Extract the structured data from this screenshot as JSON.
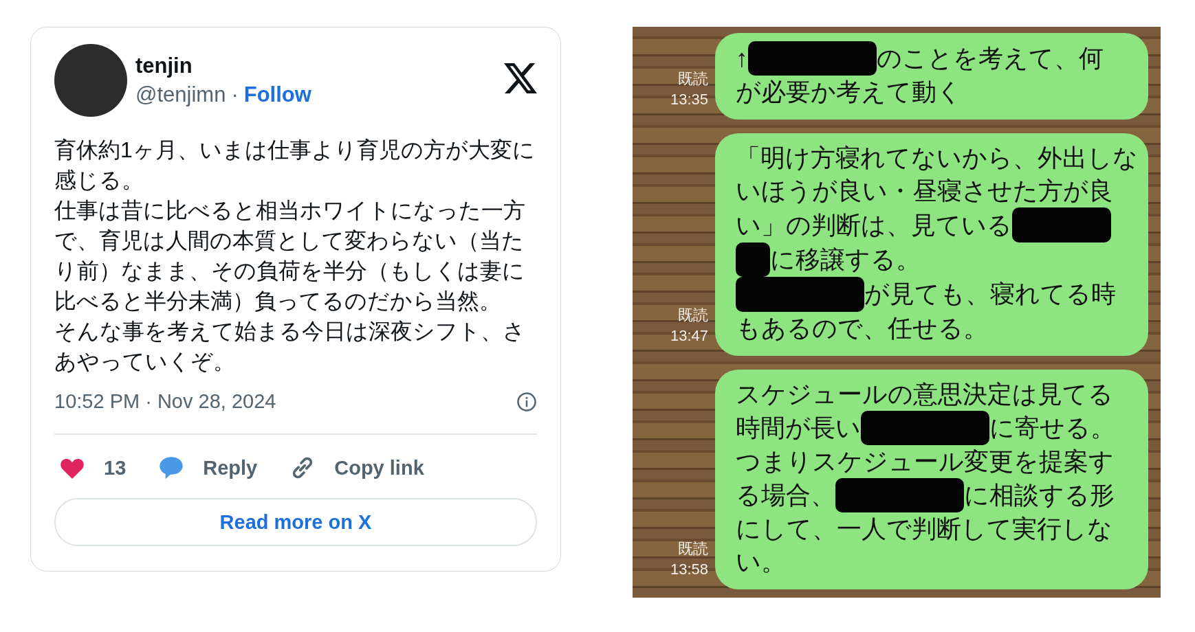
{
  "tweet": {
    "author": {
      "name": "tenjin",
      "handle": "@tenjimn",
      "separator": "·",
      "follow": "Follow"
    },
    "body": [
      "育休約1ヶ月、いまは仕事より育児の方が大変に感じる。",
      "仕事は昔に比べると相当ホワイトになった一方で、育児は人間の本質として変わらない（当たり前）なまま、その負荷を半分（もしくは妻に比べると半分未満）負ってるのだから当然。",
      "そんな事を考えて始まる今日は深夜シフト、さあやっていくぞ。"
    ],
    "timestamp": "10:52 PM · Nov 28, 2024",
    "actions": [
      {
        "kind": "like",
        "label": "13"
      },
      {
        "kind": "reply",
        "label": "Reply"
      },
      {
        "kind": "copy_link",
        "label": "Copy link"
      }
    ],
    "read_more": "Read more on X"
  },
  "chat": {
    "messages": [
      {
        "read": "既読",
        "time": "13:35",
        "lines": [
          [
            {
              "kind": "text",
              "text": "↑"
            },
            {
              "kind": "redacted_long"
            },
            {
              "kind": "text",
              "text": "のことを考えて、何"
            }
          ],
          [
            {
              "kind": "text",
              "text": "が必要か考えて動く"
            }
          ]
        ]
      },
      {
        "read": "既読",
        "time": "13:47",
        "lines": [
          [
            {
              "kind": "text",
              "text": "「明け方寝れてないから、外出しな"
            }
          ],
          [
            {
              "kind": "text",
              "text": "いほうが良い・昼寝させた方が良"
            }
          ],
          [
            {
              "kind": "text",
              "text": "い」の判断は、見ている"
            },
            {
              "kind": "redacted_medium"
            }
          ],
          [
            {
              "kind": "redacted_short"
            },
            {
              "kind": "text",
              "text": "に移譲する。"
            }
          ],
          [
            {
              "kind": "redacted_long"
            },
            {
              "kind": "text",
              "text": "が見ても、寝れてる時"
            }
          ],
          [
            {
              "kind": "text",
              "text": "もあるので、任せる。"
            }
          ]
        ]
      },
      {
        "read": "既読",
        "time": "13:58",
        "lines": [
          [
            {
              "kind": "text",
              "text": "スケジュールの意思決定は見てる"
            }
          ],
          [
            {
              "kind": "text",
              "text": "時間が長い"
            },
            {
              "kind": "redacted_long"
            },
            {
              "kind": "text",
              "text": "に寄せる。"
            }
          ],
          [
            {
              "kind": "text",
              "text": "つまりスケジュール変更を提案す"
            }
          ],
          [
            {
              "kind": "text",
              "text": "る場合、"
            },
            {
              "kind": "redacted_long"
            },
            {
              "kind": "text",
              "text": "に相談する形"
            }
          ],
          [
            {
              "kind": "text",
              "text": "にして、一人で判断して実行しな"
            }
          ],
          [
            {
              "kind": "text",
              "text": "い。"
            }
          ]
        ]
      }
    ]
  }
}
